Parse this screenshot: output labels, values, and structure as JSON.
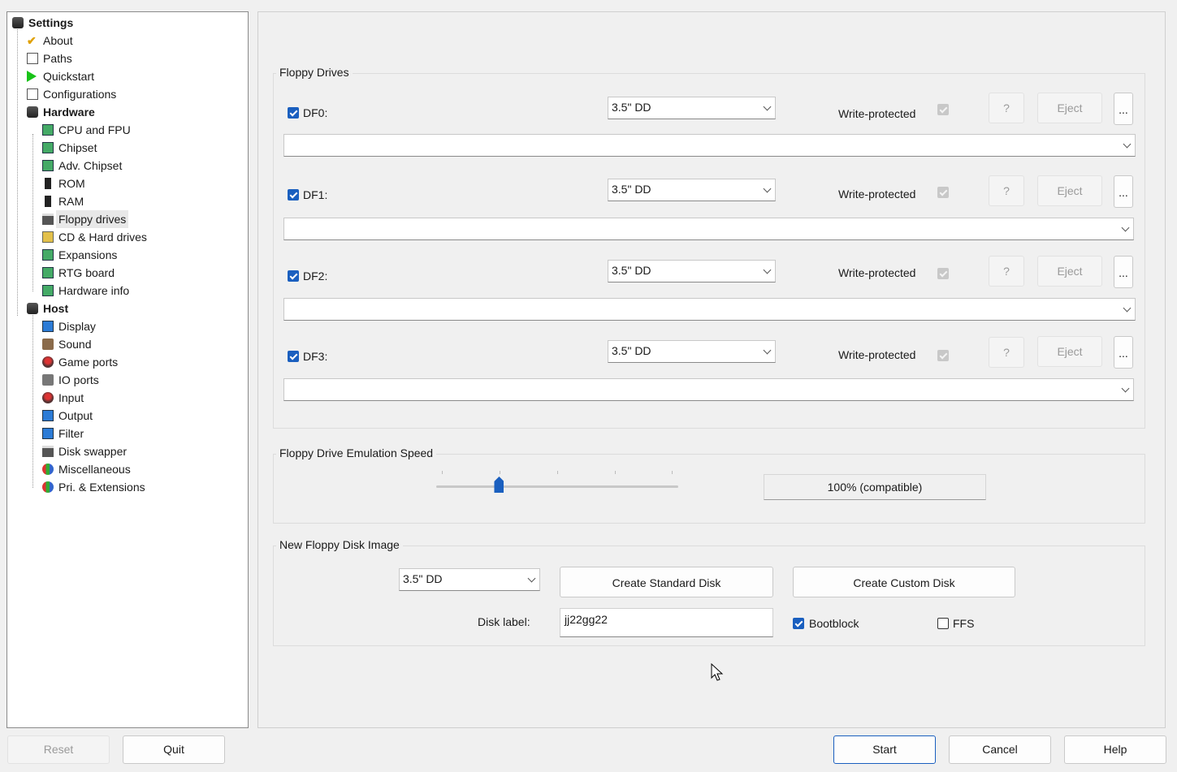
{
  "tree": {
    "items": [
      {
        "label": "Settings",
        "icon": "disk-stack-icon",
        "level": 0,
        "bold": true
      },
      {
        "label": "About",
        "icon": "checkmark-icon",
        "level": 1
      },
      {
        "label": "Paths",
        "icon": "folder-document-icon",
        "level": 1
      },
      {
        "label": "Quickstart",
        "icon": "play-icon",
        "level": 1
      },
      {
        "label": "Configurations",
        "icon": "configuration-list-icon",
        "level": 1
      },
      {
        "label": "Hardware",
        "icon": "disk-stack-icon",
        "level": 1,
        "bold": true
      },
      {
        "label": "CPU and FPU",
        "icon": "chip-icon",
        "level": 2
      },
      {
        "label": "Chipset",
        "icon": "chip-icon",
        "level": 2
      },
      {
        "label": "Adv. Chipset",
        "icon": "chip-icon",
        "level": 2
      },
      {
        "label": "ROM",
        "icon": "memory-icon",
        "level": 2
      },
      {
        "label": "RAM",
        "icon": "memory-icon",
        "level": 2
      },
      {
        "label": "Floppy drives",
        "icon": "floppy-drive-icon",
        "level": 2,
        "selected": true
      },
      {
        "label": "CD & Hard drives",
        "icon": "hard-drive-icon",
        "level": 2
      },
      {
        "label": "Expansions",
        "icon": "expansion-board-icon",
        "level": 2
      },
      {
        "label": "RTG board",
        "icon": "expansion-board-icon",
        "level": 2
      },
      {
        "label": "Hardware info",
        "icon": "expansion-board-icon",
        "level": 2
      },
      {
        "label": "Host",
        "icon": "disk-stack-icon",
        "level": 1,
        "bold": true
      },
      {
        "label": "Display",
        "icon": "monitor-icon",
        "level": 2
      },
      {
        "label": "Sound",
        "icon": "speaker-icon",
        "level": 2
      },
      {
        "label": "Game ports",
        "icon": "joystick-icon",
        "level": 2
      },
      {
        "label": "IO ports",
        "icon": "port-icon",
        "level": 2
      },
      {
        "label": "Input",
        "icon": "joystick-icon",
        "level": 2
      },
      {
        "label": "Output",
        "icon": "output-icon",
        "level": 2
      },
      {
        "label": "Filter",
        "icon": "monitor-icon",
        "level": 2
      },
      {
        "label": "Disk swapper",
        "icon": "floppy-drive-icon",
        "level": 2
      },
      {
        "label": "Miscellaneous",
        "icon": "misc-icon",
        "level": 2
      },
      {
        "label": "Pri. & Extensions",
        "icon": "misc-icon",
        "level": 2
      }
    ]
  },
  "floppy_drives": {
    "title": "Floppy Drives",
    "write_protected_label": "Write-protected",
    "help_label": "?",
    "eject_label": "Eject",
    "browse_label": "...",
    "drives": [
      {
        "name": "DF0:",
        "enabled": true,
        "type": "3.5\" DD",
        "path": ""
      },
      {
        "name": "DF1:",
        "enabled": true,
        "type": "3.5\" DD",
        "path": ""
      },
      {
        "name": "DF2:",
        "enabled": true,
        "type": "3.5\" DD",
        "path": ""
      },
      {
        "name": "DF3:",
        "enabled": true,
        "type": "3.5\" DD",
        "path": ""
      }
    ]
  },
  "emulation_speed": {
    "title": "Floppy Drive Emulation Speed",
    "value_label": "100% (compatible)",
    "slider_position": 0.26
  },
  "new_disk": {
    "title": "New Floppy Disk Image",
    "type": "3.5\" DD",
    "create_standard_label": "Create Standard Disk",
    "create_custom_label": "Create Custom Disk",
    "disk_label_caption": "Disk label:",
    "disk_label_value": "jj22gg22",
    "bootblock_label": "Bootblock",
    "bootblock_checked": true,
    "ffs_label": "FFS",
    "ffs_checked": false
  },
  "footer": {
    "reset_label": "Reset",
    "quit_label": "Quit",
    "start_label": "Start",
    "cancel_label": "Cancel",
    "help_label": "Help"
  },
  "colors": {
    "accent": "#1a5fbf",
    "background": "#f0f0f0"
  }
}
